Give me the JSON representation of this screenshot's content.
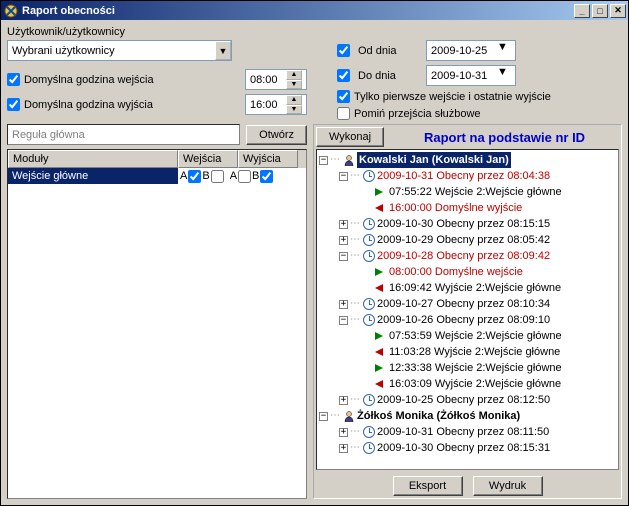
{
  "title": "Raport obecności",
  "users_label": "Użytkownik/użytkownicy",
  "users_combo": "Wybrani użytkownicy",
  "chk_entry": "Domyślna godzina wejścia",
  "chk_exit": "Domyślna godzina wyjścia",
  "time_entry": "08:00",
  "time_exit": "16:00",
  "from_label": "Od dnia",
  "to_label": "Do dnia",
  "from_date": "2009-10-25",
  "to_date": "2009-10-31",
  "chk_first": "Tylko pierwsze wejście i ostatnie wyjście",
  "chk_skip": "Pomiń przejścia służbowe",
  "rule_placeholder": "Reguła główna",
  "open_btn": "Otwórz",
  "cols": {
    "mod": "Moduły",
    "in": "Wejścia",
    "out": "Wyjścia"
  },
  "grid_row": "Wejście główne",
  "ab": {
    "a": "A",
    "b": "B"
  },
  "exec_btn": "Wykonaj",
  "report_title": "Raport na podstawie nr ID",
  "tree": {
    "p1": "Kowalski Jan (Kowalski Jan)",
    "d1": "2009-10-31  Obecny przez 08:04:38",
    "d1a": "07:55:22  Wejście 2:Wejście główne",
    "d1b": "16:00:00  Domyślne wyjście",
    "d2": "2009-10-30  Obecny przez 08:15:15",
    "d3": "2009-10-29  Obecny przez 08:05:42",
    "d4": "2009-10-28  Obecny przez 08:09:42",
    "d4a": "08:00:00  Domyślne wejście",
    "d4b": "16:09:42  Wyjście 2:Wejście główne",
    "d5": "2009-10-27  Obecny przez 08:10:34",
    "d6": "2009-10-26  Obecny przez 08:09:10",
    "d6a": "07:53:59  Wejście 2:Wejście główne",
    "d6b": "11:03:28  Wyjście 2:Wejście główne",
    "d6c": "12:33:38  Wejście 2:Wejście główne",
    "d6d": "16:03:09  Wyjście 2:Wejście główne",
    "d7": "2009-10-25  Obecny przez 08:12:50",
    "p2": "Żółkoś Monika (Żółkoś Monika)",
    "e1": "2009-10-31  Obecny przez 08:11:50",
    "e2": "2009-10-30  Obecny przez 08:15:31"
  },
  "export_btn": "Eksport",
  "print_btn": "Wydruk"
}
